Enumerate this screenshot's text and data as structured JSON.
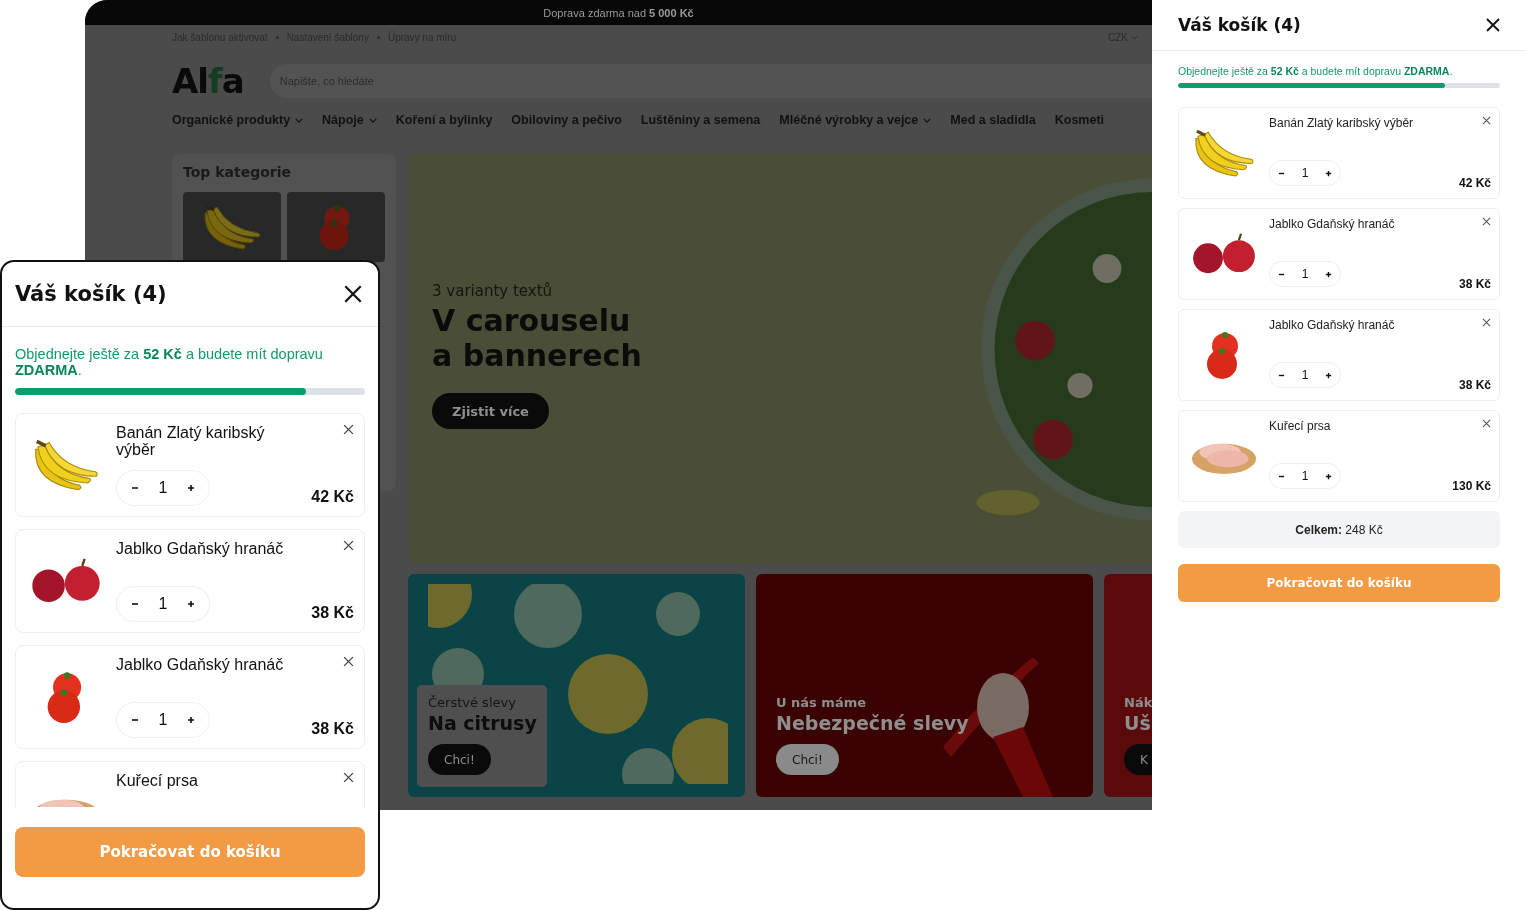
{
  "desktop": {
    "announcement": "Doprava zdarma nad **5 000 Kč**",
    "top_links": [
      "Jak šablonu aktivovat",
      "Nastavení šablony",
      "Úpravy na míru"
    ],
    "currency": "CZK",
    "logo": {
      "start": "Al",
      "accent": "f",
      "end": "a"
    },
    "search": {
      "placeholder": "Napište, co hledáte"
    },
    "categories": [
      {
        "label": "Organické produkty",
        "dropdown": true
      },
      {
        "label": "Nápoje",
        "dropdown": true
      },
      {
        "label": "Koření a bylinky",
        "dropdown": false
      },
      {
        "label": "Obiloviny a pečivo",
        "dropdown": false
      },
      {
        "label": "Luštěniny a semena",
        "dropdown": false
      },
      {
        "label": "Mléčné výrobky a vejce",
        "dropdown": true
      },
      {
        "label": "Med a sladidla",
        "dropdown": false
      },
      {
        "label": "Kosmeti",
        "dropdown": false
      }
    ],
    "top_categories": {
      "title": "Top kategorie",
      "items": [
        {
          "kind": "banana"
        },
        {
          "kind": "tomato"
        }
      ]
    },
    "hero": {
      "kicker": "3 varianty textů",
      "title_lines": [
        "V carouselu",
        "a bannerech"
      ],
      "button": "Zjistit více"
    },
    "banners": [
      {
        "kind": "citrus",
        "kicker": "Čerstvé slevy",
        "title": "Na citrusy",
        "button": "Chci!"
      },
      {
        "kind": "chili",
        "kicker": "U nás máme",
        "title": "Nebezpečné slevy",
        "button": "Chci!"
      },
      {
        "kind": "plain",
        "kicker": "Nák",
        "title": "Uš",
        "button": "K"
      }
    ]
  },
  "cart_drawer": {
    "title": "Váš košík (4)",
    "free_shipping": "Objednejte ještě za **52 Kč** a budete mít dopravu **ZDARMA**.",
    "level": 0.83,
    "items": [
      {
        "kind": "banana",
        "name": "Banán Zlatý karibský výběr",
        "quantity": "1",
        "price": "42 Kč"
      },
      {
        "kind": "apple",
        "name": "Jablko Gdaňský hranáč",
        "quantity": "1",
        "price": "38 Kč"
      },
      {
        "kind": "tomato",
        "name": "Jablko Gdaňský hranáč",
        "quantity": "1",
        "price": "38 Kč"
      },
      {
        "kind": "chicken",
        "name": "Kuřecí prsa",
        "quantity": "1",
        "price": "130 Kč"
      }
    ],
    "total": "**Celkem:** 248 Kč",
    "checkout": "Pokračovat do košíku"
  },
  "mobile_cart": {
    "title": "Váš košík (4)",
    "free_shipping": "Objednejte ještě za **52 Kč** a budete mít dopravu **ZDARMA**.",
    "level": 0.83,
    "items": [
      {
        "kind": "banana",
        "name": "Banán Zlatý karibský výběr",
        "quantity": "1",
        "price": "42 Kč"
      },
      {
        "kind": "apple",
        "name": "Jablko Gdaňský hranáč",
        "quantity": "1",
        "price": "38 Kč"
      },
      {
        "kind": "tomato",
        "name": "Jablko Gdaňský hranáč",
        "quantity": "1",
        "price": "38 Kč"
      },
      {
        "kind": "chicken",
        "name": "Kuřecí prsa"
      }
    ],
    "checkout": "Pokračovat do košíku"
  }
}
